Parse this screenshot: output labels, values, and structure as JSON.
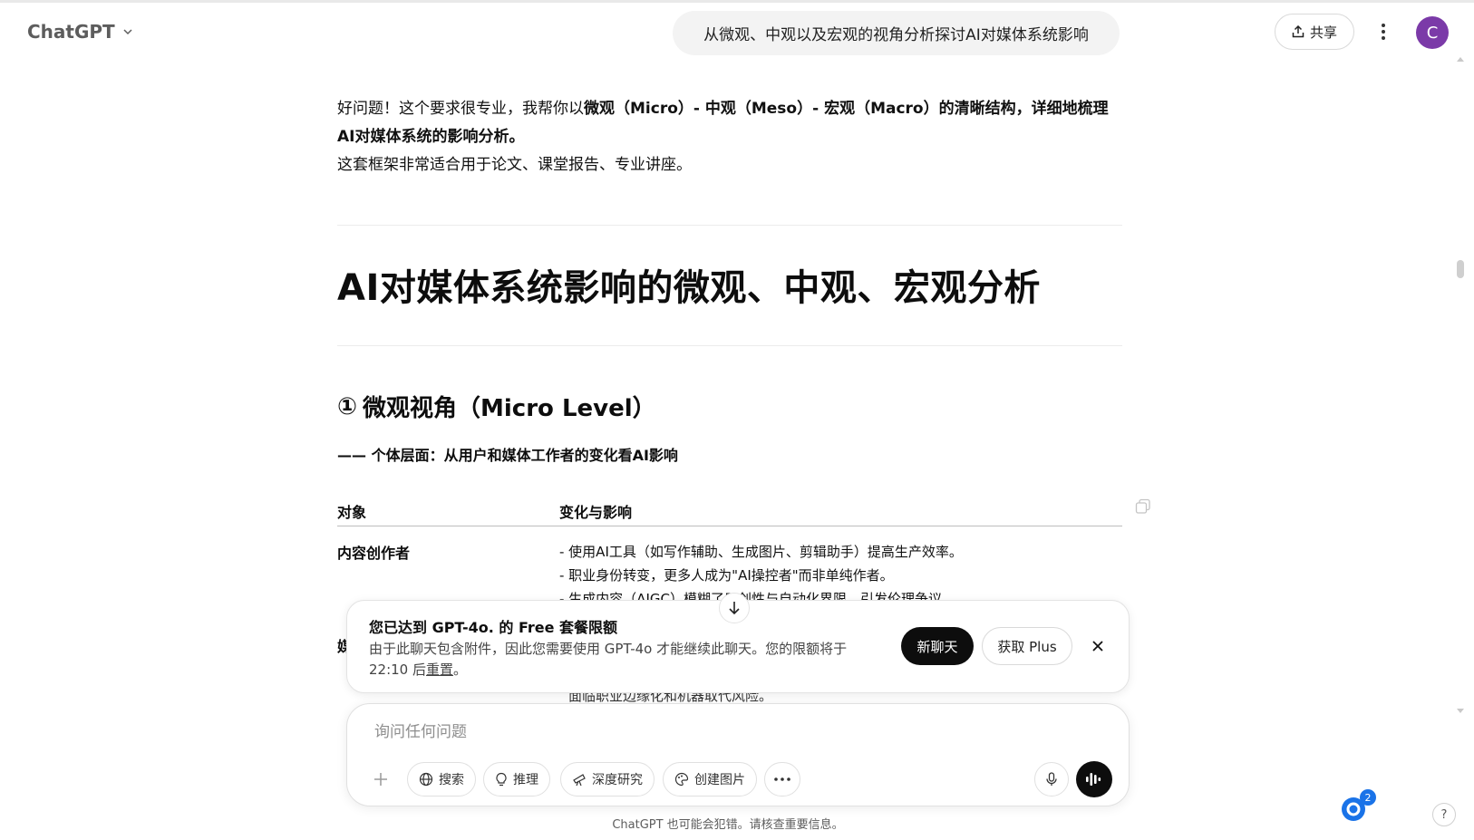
{
  "header": {
    "model_name": "ChatGPT",
    "conversation_title": "从微观、中观以及宏观的视角分析探讨AI对媒体系统影响",
    "share_label": "共享",
    "avatar_letter": "C"
  },
  "message": {
    "intro_plain": "好问题！这个要求很专业，我帮你以",
    "intro_bold": "微观（Micro）- 中观（Meso）- 宏观（Macro）的清晰结构，详细地梳理AI对媒体系统的影响分析。",
    "intro_line2": "这套框架非常适合用于论文、课堂报告、专业讲座。",
    "heading": "AI对媒体系统影响的微观、中观、宏观分析",
    "section_number": "①",
    "section_title": "微观视角（Micro Level）",
    "section_subtitle": "—— 个体层面：从用户和媒体工作者的变化看AI影响",
    "table": {
      "col_object": "对象",
      "col_change": "变化与影响",
      "row1_label": "内容创作者",
      "row1_lines": [
        "- 使用AI工具（如写作辅助、生成图片、剪辑助手）提高生产效率。",
        "- 职业身份转变，更多人成为\"AI操控者\"而非单纯作者。",
        "- 生成内容（AIGC）模糊了原创性与自动化界限，引发伦理争议。"
      ],
      "row2_label_partial": "媒",
      "row2_partial_line": "面临职业边缘化和机器取代风险。"
    }
  },
  "limit_banner": {
    "title": "您已达到 GPT-4o. 的 Free 套餐限额",
    "desc_prefix": "由于此聊天包含附件，因此您需要使用 GPT-4o 才能继续此聊天。您的限额将于 22:10 后",
    "desc_link": "重置",
    "desc_suffix": "。",
    "new_chat": "新聊天",
    "get_plus": "获取 Plus"
  },
  "composer": {
    "placeholder": "询问任何问题",
    "tools": [
      "搜索",
      "推理",
      "深度研究",
      "创建图片"
    ]
  },
  "footer": {
    "disclaimer": "ChatGPT 也可能会犯错。请核查重要信息。",
    "notification_count": "2",
    "help": "?"
  }
}
